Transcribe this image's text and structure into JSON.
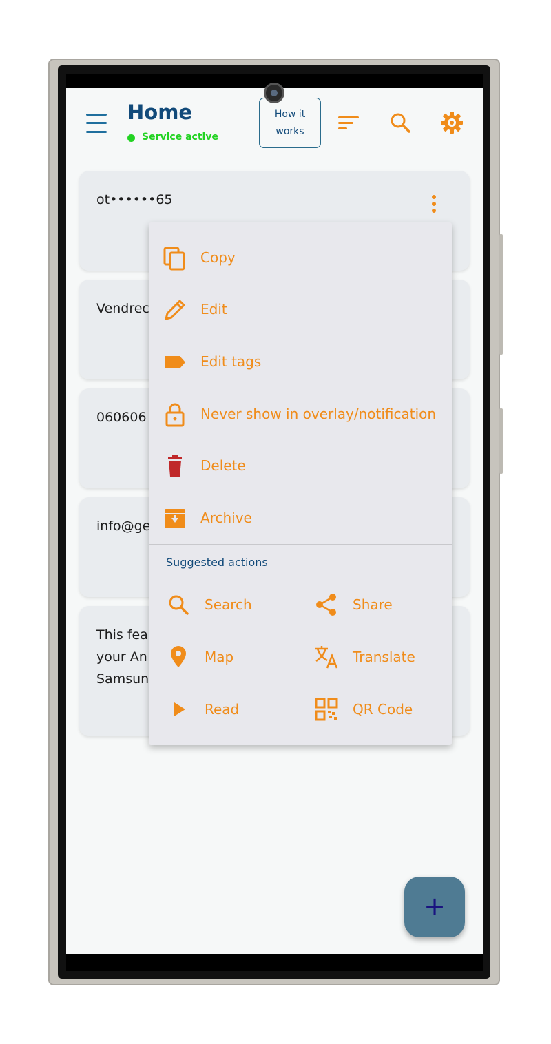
{
  "header": {
    "title": "Home",
    "status": "Service active",
    "how_it_works_line1": "How it",
    "how_it_works_line2": "works",
    "icons": [
      "menu-icon",
      "sort-icon",
      "search-icon",
      "settings-icon"
    ]
  },
  "cards": [
    {
      "text": "ot••••••65"
    },
    {
      "text": "Vendrec"
    },
    {
      "text": "060606"
    },
    {
      "text": "info@ge"
    },
    {
      "line1": "This fea",
      "line2": "your An",
      "line3": "Samsun"
    }
  ],
  "menu": {
    "items": [
      {
        "label": "Copy",
        "icon": "copy-icon"
      },
      {
        "label": "Edit",
        "icon": "pencil-icon"
      },
      {
        "label": "Edit tags",
        "icon": "tag-icon"
      },
      {
        "label": "Never show in overlay/notification",
        "icon": "lock-icon"
      },
      {
        "label": "Delete",
        "icon": "trash-icon"
      },
      {
        "label": "Archive",
        "icon": "archive-icon"
      }
    ],
    "suggested_title": "Suggested actions",
    "suggested": [
      {
        "label": "Search",
        "icon": "search-icon"
      },
      {
        "label": "Share",
        "icon": "share-icon"
      },
      {
        "label": "Map",
        "icon": "map-pin-icon"
      },
      {
        "label": "Translate",
        "icon": "translate-icon"
      },
      {
        "label": "Read",
        "icon": "play-icon"
      },
      {
        "label": "QR Code",
        "icon": "qr-code-icon"
      }
    ]
  },
  "fab": {
    "label": "+"
  },
  "colors": {
    "accent": "#f08c1a",
    "primary": "#124a7a",
    "status": "#22d322",
    "delete": "#c0282a",
    "fab": "#4f7b93"
  }
}
